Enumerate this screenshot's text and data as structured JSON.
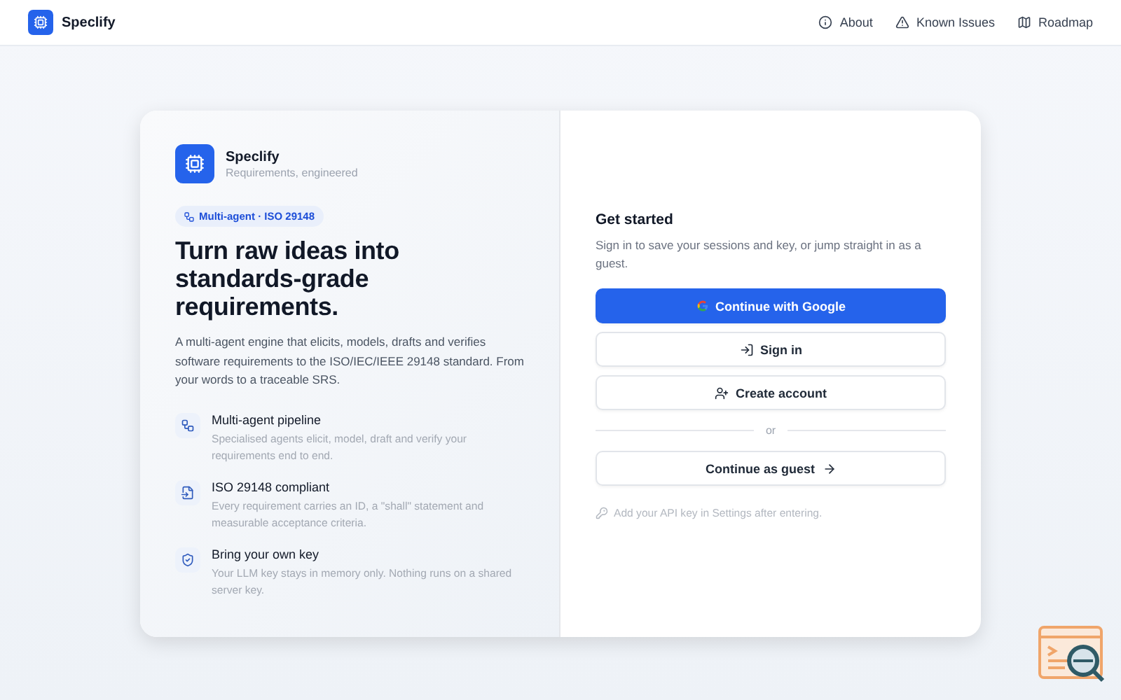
{
  "header": {
    "brand": "Speclify",
    "nav": [
      {
        "kind": "info",
        "label": "About"
      },
      {
        "kind": "warning",
        "label": "Known Issues"
      },
      {
        "kind": "map",
        "label": "Roadmap"
      }
    ]
  },
  "intro": {
    "brand": "Speclify",
    "tagline": "Requirements, engineered",
    "badge": "Multi-agent · ISO 29148",
    "headline": "Turn raw ideas into standards-grade requirements.",
    "description": "A multi-agent engine that elicits, models, drafts and verifies software requirements to the ISO/IEC/IEEE 29148 standard. From your words to a traceable SRS.",
    "features": [
      {
        "kind": "pipeline",
        "title": "Multi-agent pipeline",
        "text": "Specialised agents elicit, model, draft and verify your requirements end to end."
      },
      {
        "kind": "document",
        "title": "ISO 29148 compliant",
        "text": "Every requirement carries an ID, a \"shall\" statement and measurable acceptance criteria."
      },
      {
        "kind": "shield",
        "title": "Bring your own key",
        "text": "Your LLM key stays in memory only. Nothing runs on a shared server key."
      }
    ]
  },
  "auth": {
    "title": "Get started",
    "subtitle": "Sign in to save your sessions and key, or jump straight in as a guest.",
    "buttons": [
      {
        "kind": "google",
        "label": "Continue with Google"
      },
      {
        "kind": "signin",
        "label": "Sign in"
      },
      {
        "kind": "create",
        "label": "Create account"
      }
    ],
    "divider": "or",
    "guest": "Continue as guest",
    "hint": "Add your API key in Settings after entering."
  }
}
